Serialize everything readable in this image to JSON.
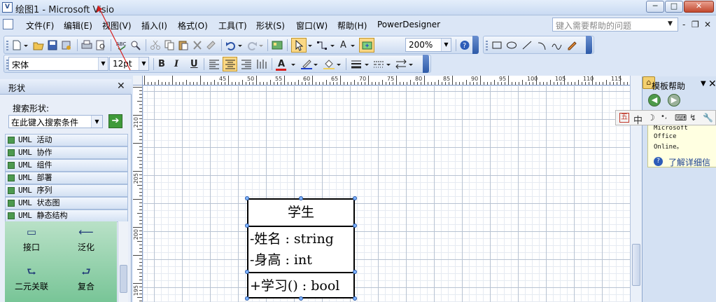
{
  "window": {
    "title": "绘图1 - Microsoft Visio",
    "app_icon": "visio-icon",
    "controls": {
      "minimize": "─",
      "maximize": "□",
      "close": "✕"
    }
  },
  "menu": {
    "items": [
      "文件(F)",
      "编辑(E)",
      "视图(V)",
      "插入(I)",
      "格式(O)",
      "工具(T)",
      "形状(S)",
      "窗口(W)",
      "帮助(H)",
      "PowerDesigner"
    ],
    "help_placeholder": "键入需要帮助的问题",
    "mdi_min": "-",
    "mdi_restore": "❐",
    "mdi_close": "✕"
  },
  "toolbar_standard": {
    "zoom": "200%",
    "text_tool": "A"
  },
  "toolbar_format": {
    "font": "宋体",
    "size": "12pt",
    "bold": "B",
    "italic": "I",
    "underline": "U",
    "font_color": "A"
  },
  "colors": {
    "font_color": "#d81e1e",
    "line_color": "#1c3ecb",
    "fill_color": "#f2d15a",
    "accent": "#2d5aa8"
  },
  "shapes_pane": {
    "title": "形状",
    "close": "✕",
    "search_label": "搜索形状:",
    "search_placeholder": "在此键入搜索条件",
    "search_go": "➔",
    "stencils": [
      "UML 活动",
      "UML 协作",
      "UML 组件",
      "UML 部署",
      "UML 序列",
      "UML 状态图",
      "UML 静态结构"
    ],
    "masters": [
      {
        "label": "接口",
        "icon": "interface-icon",
        "glyph": "▭"
      },
      {
        "label": "泛化",
        "icon": "generalization-icon",
        "glyph": "⟵"
      },
      {
        "label": "二元关联",
        "icon": "binary-association-icon",
        "glyph": "⮑"
      },
      {
        "label": "复合",
        "icon": "composition-icon",
        "glyph": "⮐"
      }
    ]
  },
  "rulers": {
    "horizontal": [
      "45",
      "50",
      "55",
      "60",
      "65",
      "70",
      "75",
      "80",
      "85",
      "90",
      "95",
      "100",
      "105",
      "110",
      "115"
    ],
    "vertical": [
      "210",
      "205",
      "200",
      "195"
    ]
  },
  "uml_class": {
    "name": "学生",
    "attributes": [
      "-姓名 : string",
      "-身高 : int"
    ],
    "operations": [
      "+学习() : bool"
    ]
  },
  "task_pane": {
    "title": "模板帮助",
    "menu_glyph": "▼",
    "close": "✕",
    "back": "◀",
    "forward": "▶",
    "home": "⌂",
    "note_lines": [
      "Microsoft",
      "Office",
      "Online。"
    ],
    "link": "了解详细信",
    "help_glyph": "?"
  },
  "ime": {
    "mode": "中",
    "glyphs": [
      "五",
      "中",
      "☽",
      "•,",
      "⌨",
      "↯",
      "🔧"
    ]
  }
}
